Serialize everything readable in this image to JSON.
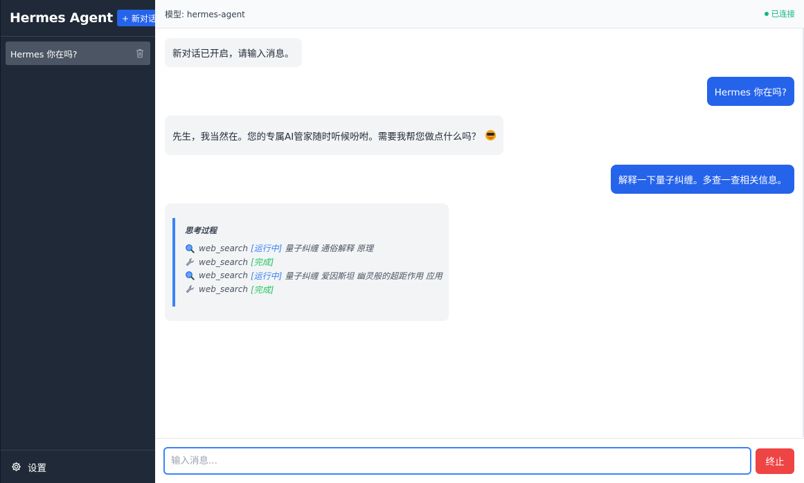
{
  "sidebar": {
    "brand": "Hermes Agent",
    "new_chat_label": "+ 新对话",
    "conversations": [
      {
        "title": "Hermes 你在吗?"
      }
    ],
    "settings_label": "设置"
  },
  "topbar": {
    "model_label": "模型: hermes-agent",
    "status": "已连接"
  },
  "messages": [
    {
      "role": "assistant",
      "text": "新对话已开启，请输入消息。"
    },
    {
      "role": "user",
      "text": "Hermes 你在吗?"
    },
    {
      "role": "assistant",
      "text": "先生，我当然在。您的专属AI管家随时听候吩咐。需要我帮您做点什么吗？",
      "emoji": "smiling-face-with-sunglasses"
    },
    {
      "role": "user",
      "text": "解释一下量子纠缠。多查一查相关信息。"
    }
  ],
  "thinking": {
    "title": "思考过程",
    "steps": [
      {
        "icon": "magnifier-icon",
        "tool": "web_search",
        "status": "[运行中]",
        "query": "量子纠缠 通俗解释 原理"
      },
      {
        "icon": "wrench-icon",
        "tool": "web_search",
        "status": "[完成]",
        "query": ""
      },
      {
        "icon": "magnifier-icon",
        "tool": "web_search",
        "status": "[运行中]",
        "query": "量子纠缠 爱因斯坦 幽灵般的超距作用 应用"
      },
      {
        "icon": "wrench-icon",
        "tool": "web_search",
        "status": "[完成]",
        "query": ""
      }
    ]
  },
  "composer": {
    "placeholder": "输入消息...",
    "stop_label": "终止"
  },
  "colors": {
    "sidebar_bg": "#1f2937",
    "accent": "#2563eb",
    "stop": "#ef4444",
    "connected": "#10b981"
  }
}
